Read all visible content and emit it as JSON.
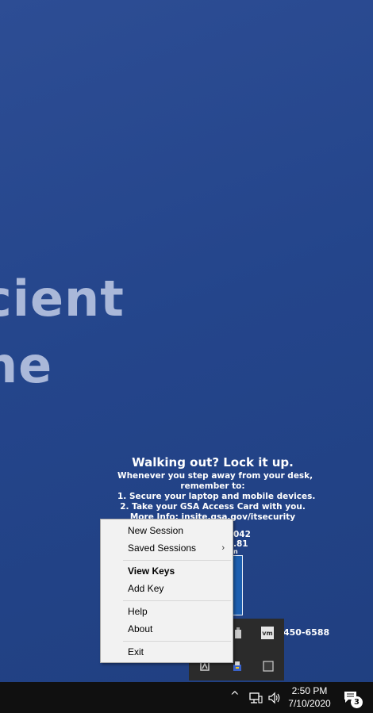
{
  "wallpaper": {
    "big_line_1": "cient",
    "big_line_2": "ne",
    "notice": {
      "heading": "Walking out? Lock it up.",
      "line1": "Whenever you step away from your desk,",
      "line2": "remember to:",
      "line3": "1. Secure your laptop and mobile devices.",
      "line4": "2. Take your GSA Access Card with you.",
      "line5": "More Info:  insite.gsa.gov/itsecurity"
    },
    "partial_1": "042",
    "partial_2": ".81",
    "partial_3": "n",
    "phone_partial": "450-6588"
  },
  "context_menu": {
    "items": [
      {
        "label": "New Session"
      },
      {
        "label": "Saved Sessions",
        "submenu_arrow": "›"
      },
      {
        "label": "View Keys",
        "bold": true
      },
      {
        "label": "Add Key"
      },
      {
        "label": "Help"
      },
      {
        "label": "About"
      },
      {
        "label": "Exit"
      }
    ]
  },
  "tray_flyout": {
    "icons": [
      "usb-eject-icon",
      "vmware-icon",
      "pageant-key-icon",
      "network-drive-icon",
      "square-app-icon"
    ],
    "vm_text": "vm"
  },
  "taskbar": {
    "time": "2:50 PM",
    "date": "7/10/2020",
    "notification_count": "3",
    "chevron": "^"
  },
  "colors": {
    "wallpaper": "#24458b",
    "taskbar": "#101010",
    "menu_bg": "#f2f2f2"
  }
}
